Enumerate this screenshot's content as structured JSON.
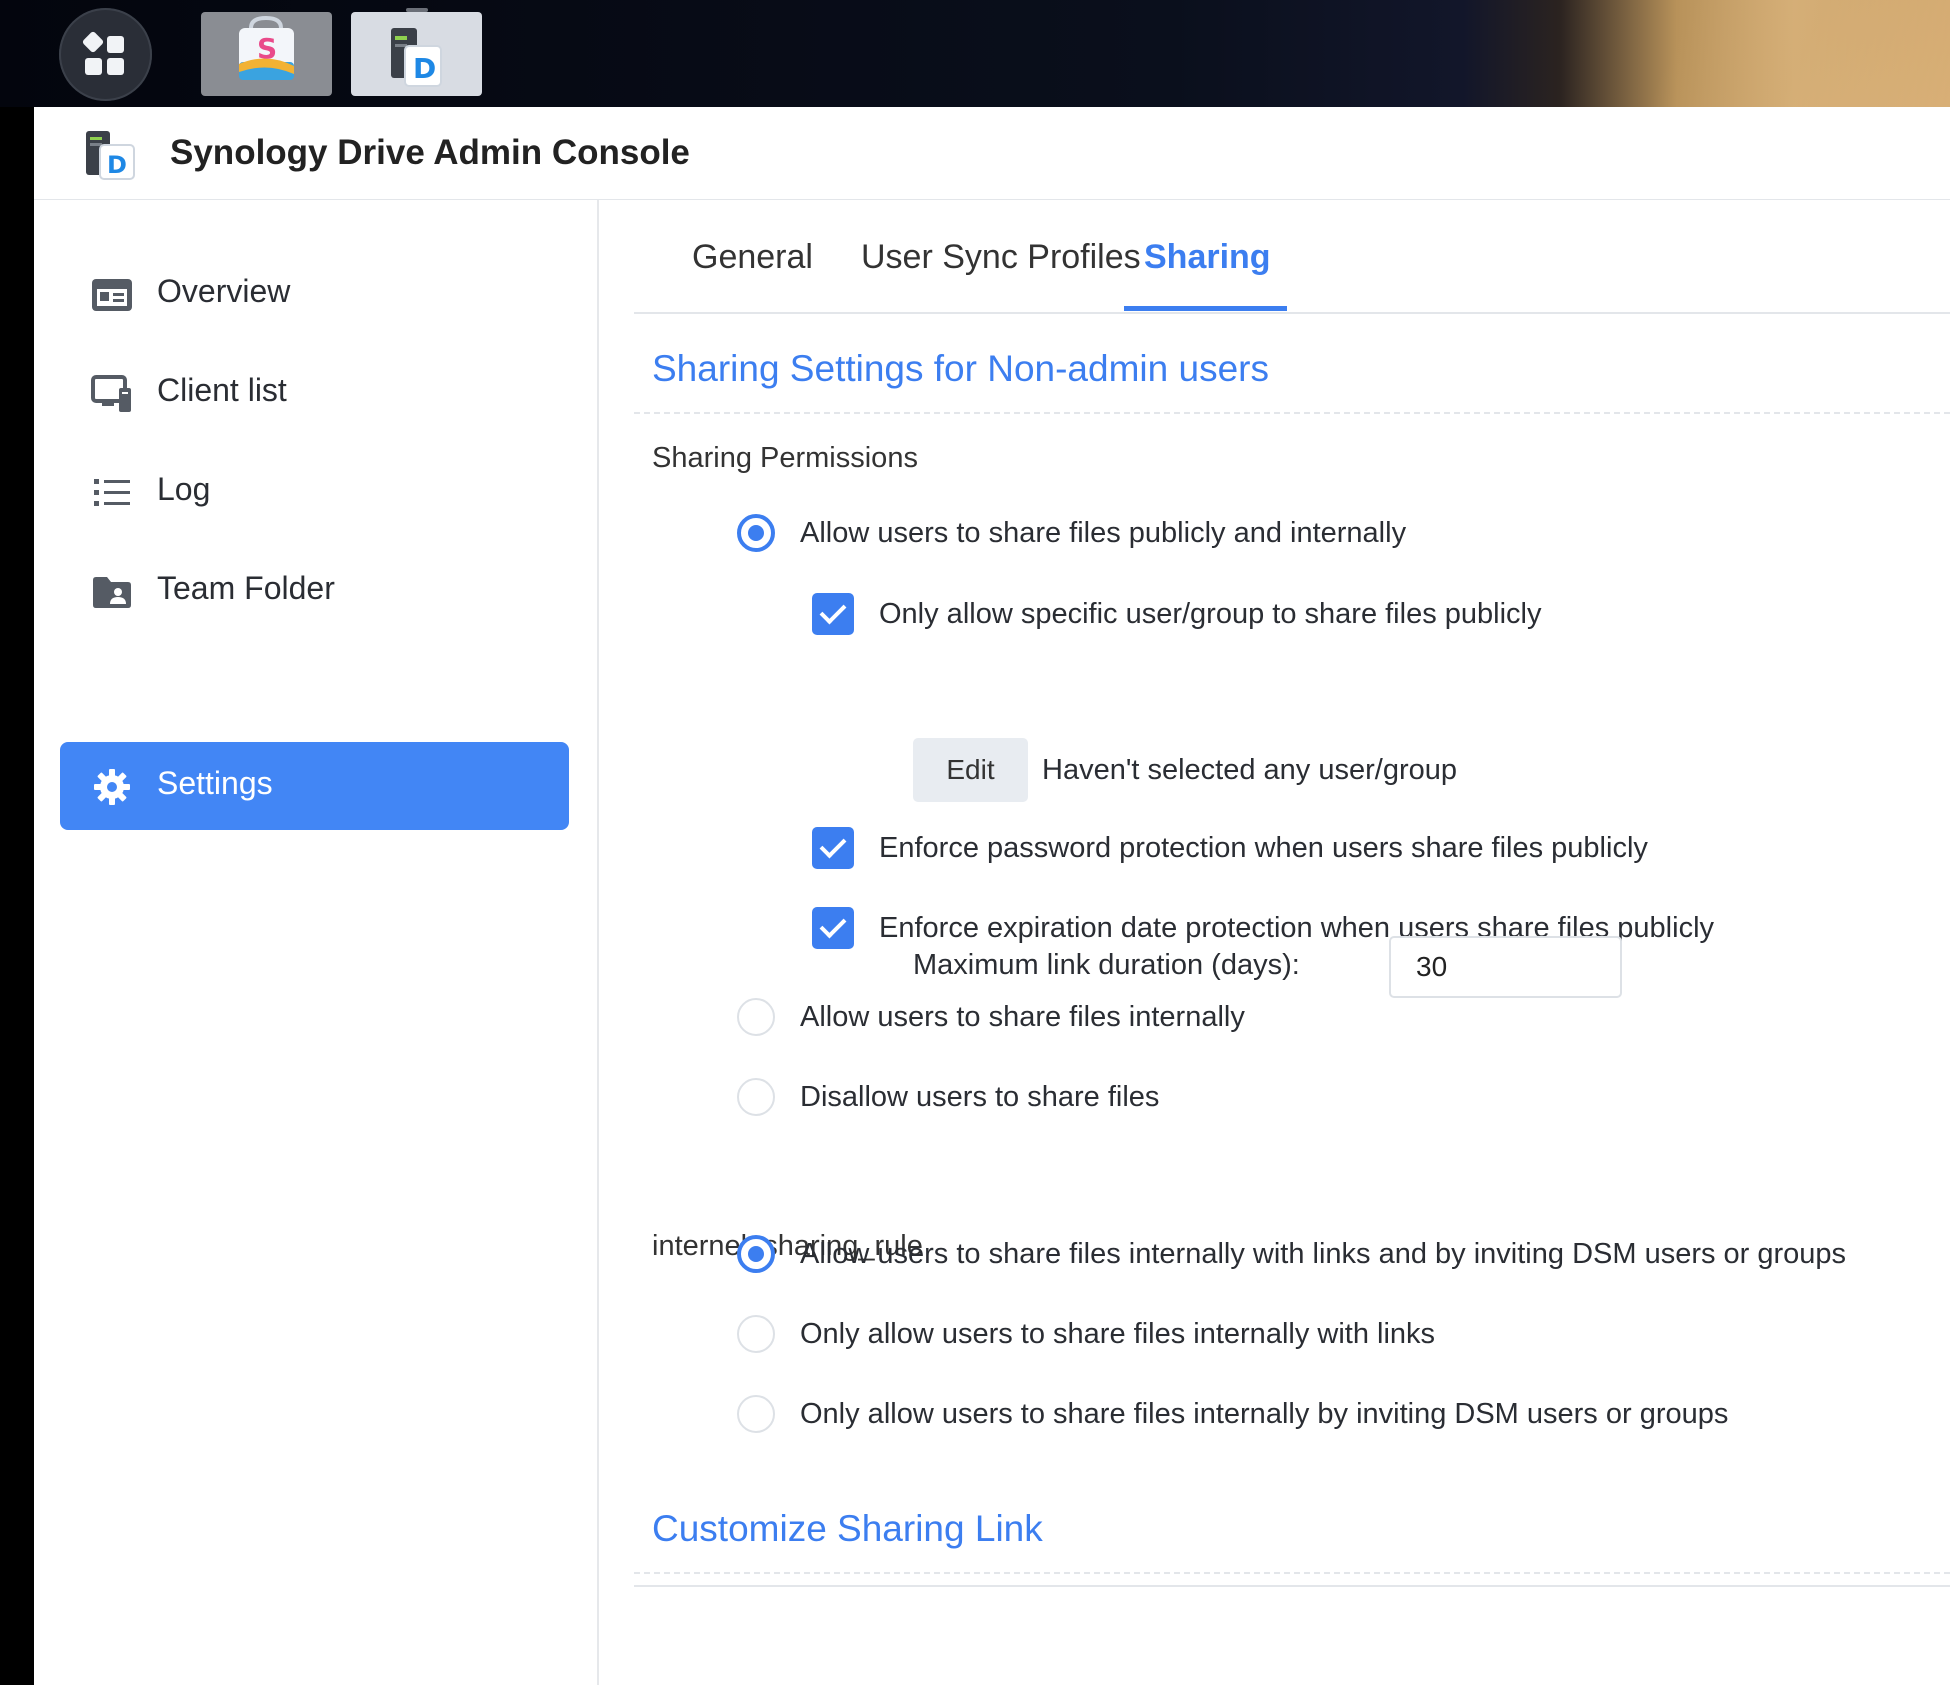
{
  "app": {
    "title": "Synology Drive Admin Console"
  },
  "taskbar": {
    "main_menu_icon": "grid-icon",
    "apps": [
      {
        "name": "package-center-icon"
      },
      {
        "name": "synology-drive-icon"
      }
    ]
  },
  "sidebar": {
    "items": [
      {
        "label": "Overview",
        "icon": "overview-icon",
        "active": false
      },
      {
        "label": "Client list",
        "icon": "client-list-icon",
        "active": false
      },
      {
        "label": "Log",
        "icon": "log-list-icon",
        "active": false
      },
      {
        "label": "Team Folder",
        "icon": "team-folder-icon",
        "active": false
      },
      {
        "label": "Settings",
        "icon": "gear-icon",
        "active": true
      }
    ]
  },
  "tabs": [
    {
      "label": "General",
      "active": false
    },
    {
      "label": "User Sync Profiles",
      "active": false
    },
    {
      "label": "Sharing",
      "active": true
    }
  ],
  "sharing": {
    "section_title": "Sharing Settings for Non-admin users",
    "permissions": {
      "label": "Sharing Permissions",
      "options": [
        {
          "label": "Allow users to share files publicly and internally",
          "selected": true
        },
        {
          "label": "Allow users to share files internally",
          "selected": false
        },
        {
          "label": "Disallow users to share files",
          "selected": false
        }
      ],
      "sub_options": [
        {
          "label": "Only allow specific user/group to share files publicly",
          "checked": true
        },
        {
          "label": "Enforce password protection when users share files publicly",
          "checked": true
        },
        {
          "label": "Enforce expiration date protection when users share files publicly",
          "checked": true
        }
      ],
      "edit_button": "Edit",
      "edit_hint": "Haven't selected any user/group",
      "max_duration_label": "Maximum link duration (days):",
      "max_duration_value": "30"
    },
    "internal_rule": {
      "label": "internel_sharing_rule",
      "options": [
        {
          "label": "Allow users to share files internally with links and by inviting DSM users or groups",
          "selected": true
        },
        {
          "label": "Only allow users to share files internally with links",
          "selected": false
        },
        {
          "label": "Only allow users to share files internally by inviting DSM users or groups",
          "selected": false
        }
      ]
    },
    "customize_title": "Customize Sharing Link"
  },
  "colors": {
    "accent": "#3c7ef0",
    "sidebar_active": "#4286f5"
  }
}
